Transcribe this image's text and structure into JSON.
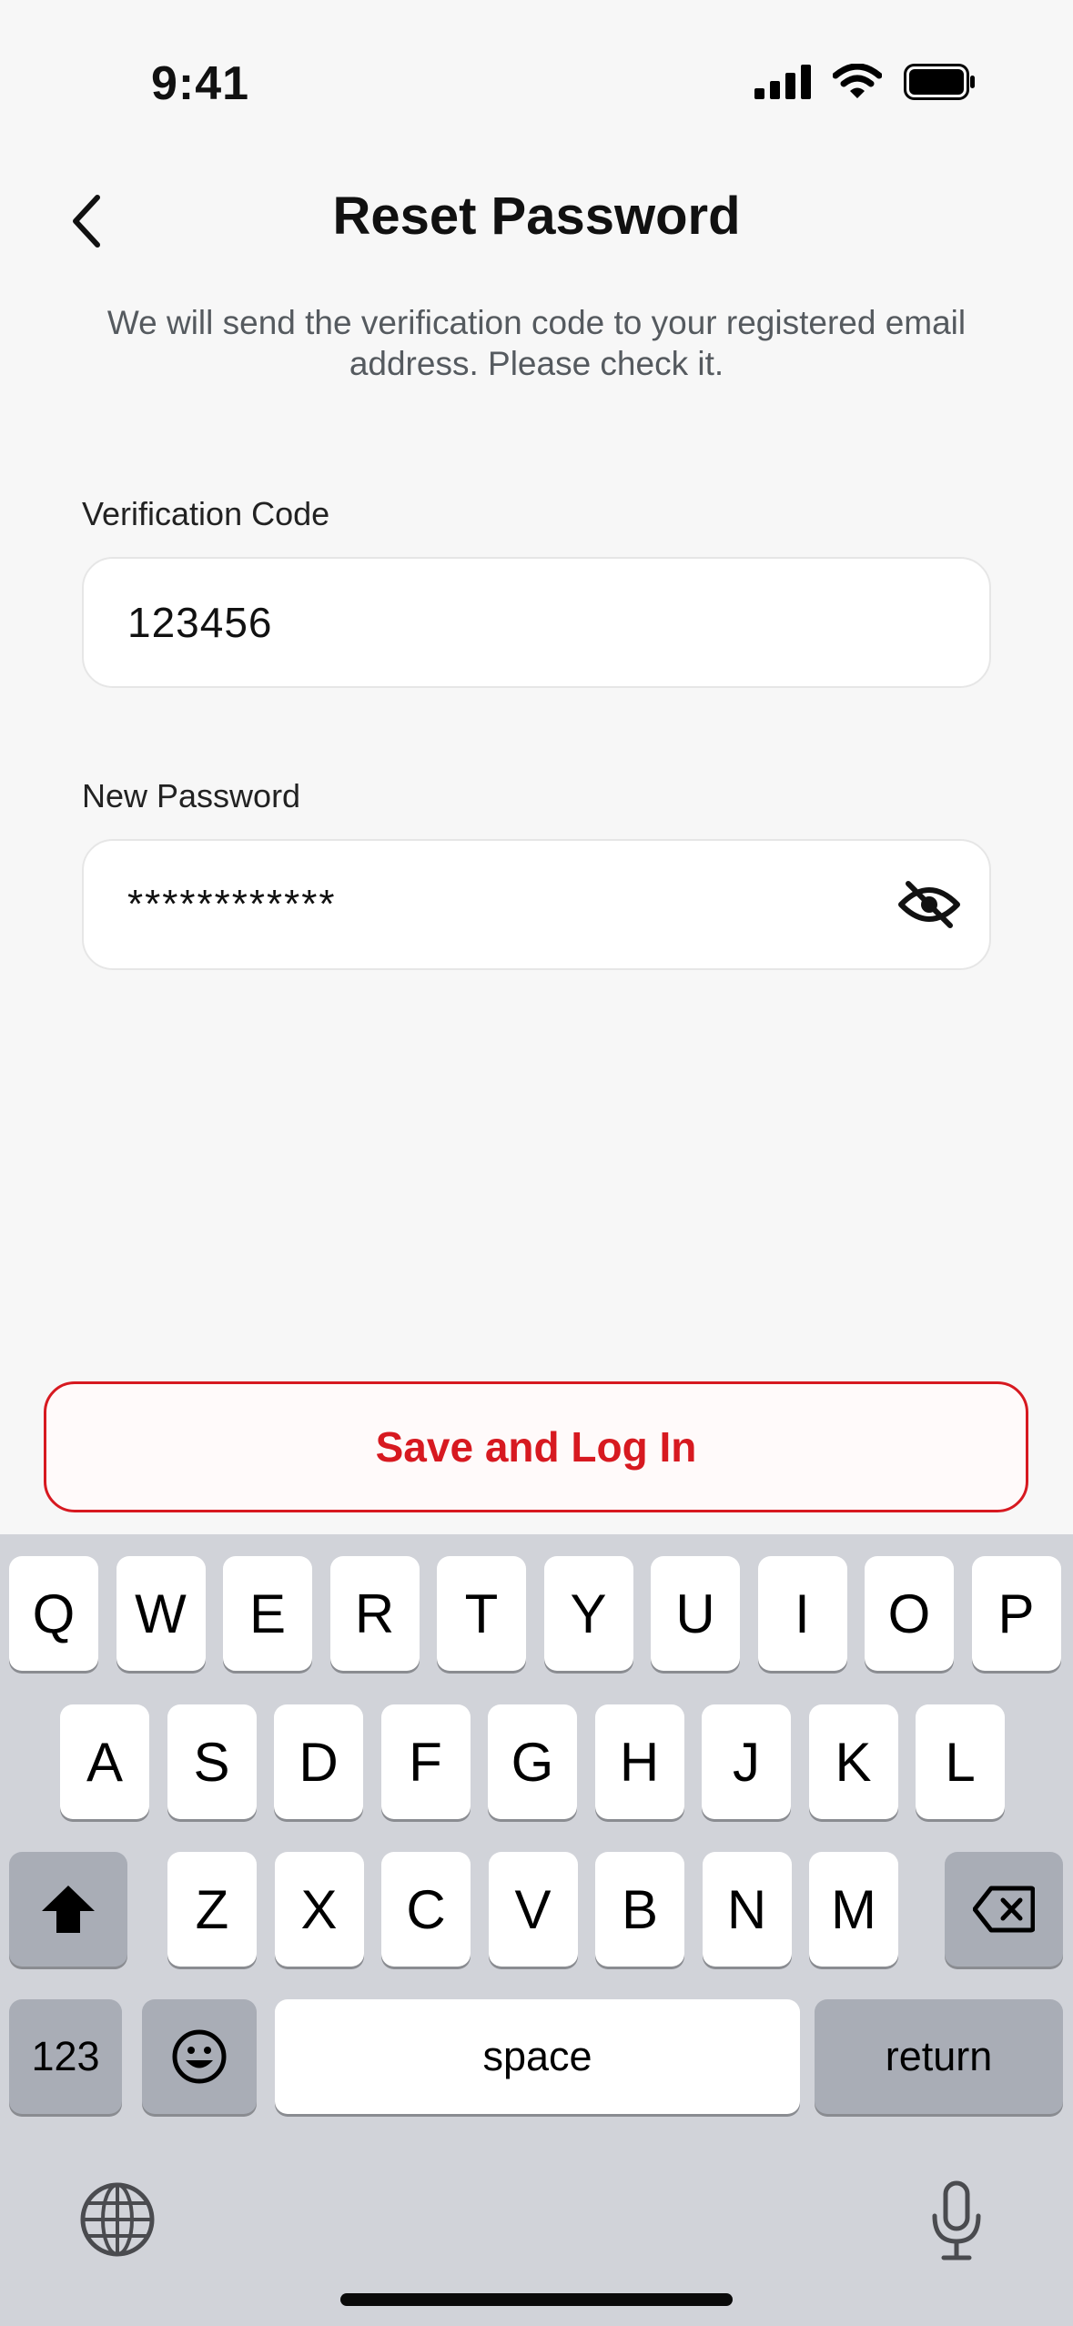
{
  "status_bar": {
    "time": "9:41",
    "icons": [
      "cellular-signal-icon",
      "wifi-icon",
      "battery-icon"
    ]
  },
  "header": {
    "back_icon": "chevron-left-icon",
    "title": "Reset Password",
    "subtitle": "We will send the verification code to your registered email address. Please check it."
  },
  "form": {
    "verification_code": {
      "label": "Verification Code",
      "value": "123456"
    },
    "new_password": {
      "label": "New Password",
      "value": "************",
      "toggle_icon": "eye-slash-icon"
    }
  },
  "actions": {
    "submit_label": "Save and Log In"
  },
  "colors": {
    "accent": "#d71920",
    "background": "#f7f7f7",
    "keyboard_background": "#d1d3d9",
    "key": "#ffffff",
    "key_dark": "#a9adb6"
  },
  "keyboard": {
    "row1": [
      "Q",
      "W",
      "E",
      "R",
      "T",
      "Y",
      "U",
      "I",
      "O",
      "P"
    ],
    "row2": [
      "A",
      "S",
      "D",
      "F",
      "G",
      "H",
      "J",
      "K",
      "L"
    ],
    "row3": [
      "Z",
      "X",
      "C",
      "V",
      "B",
      "N",
      "M"
    ],
    "shift_icon": "shift-arrow-icon",
    "delete_icon": "backspace-icon",
    "numbers_label": "123",
    "emoji_icon": "emoji-icon",
    "space_label": "space",
    "return_label": "return",
    "globe_icon": "globe-icon",
    "mic_icon": "microphone-icon"
  }
}
